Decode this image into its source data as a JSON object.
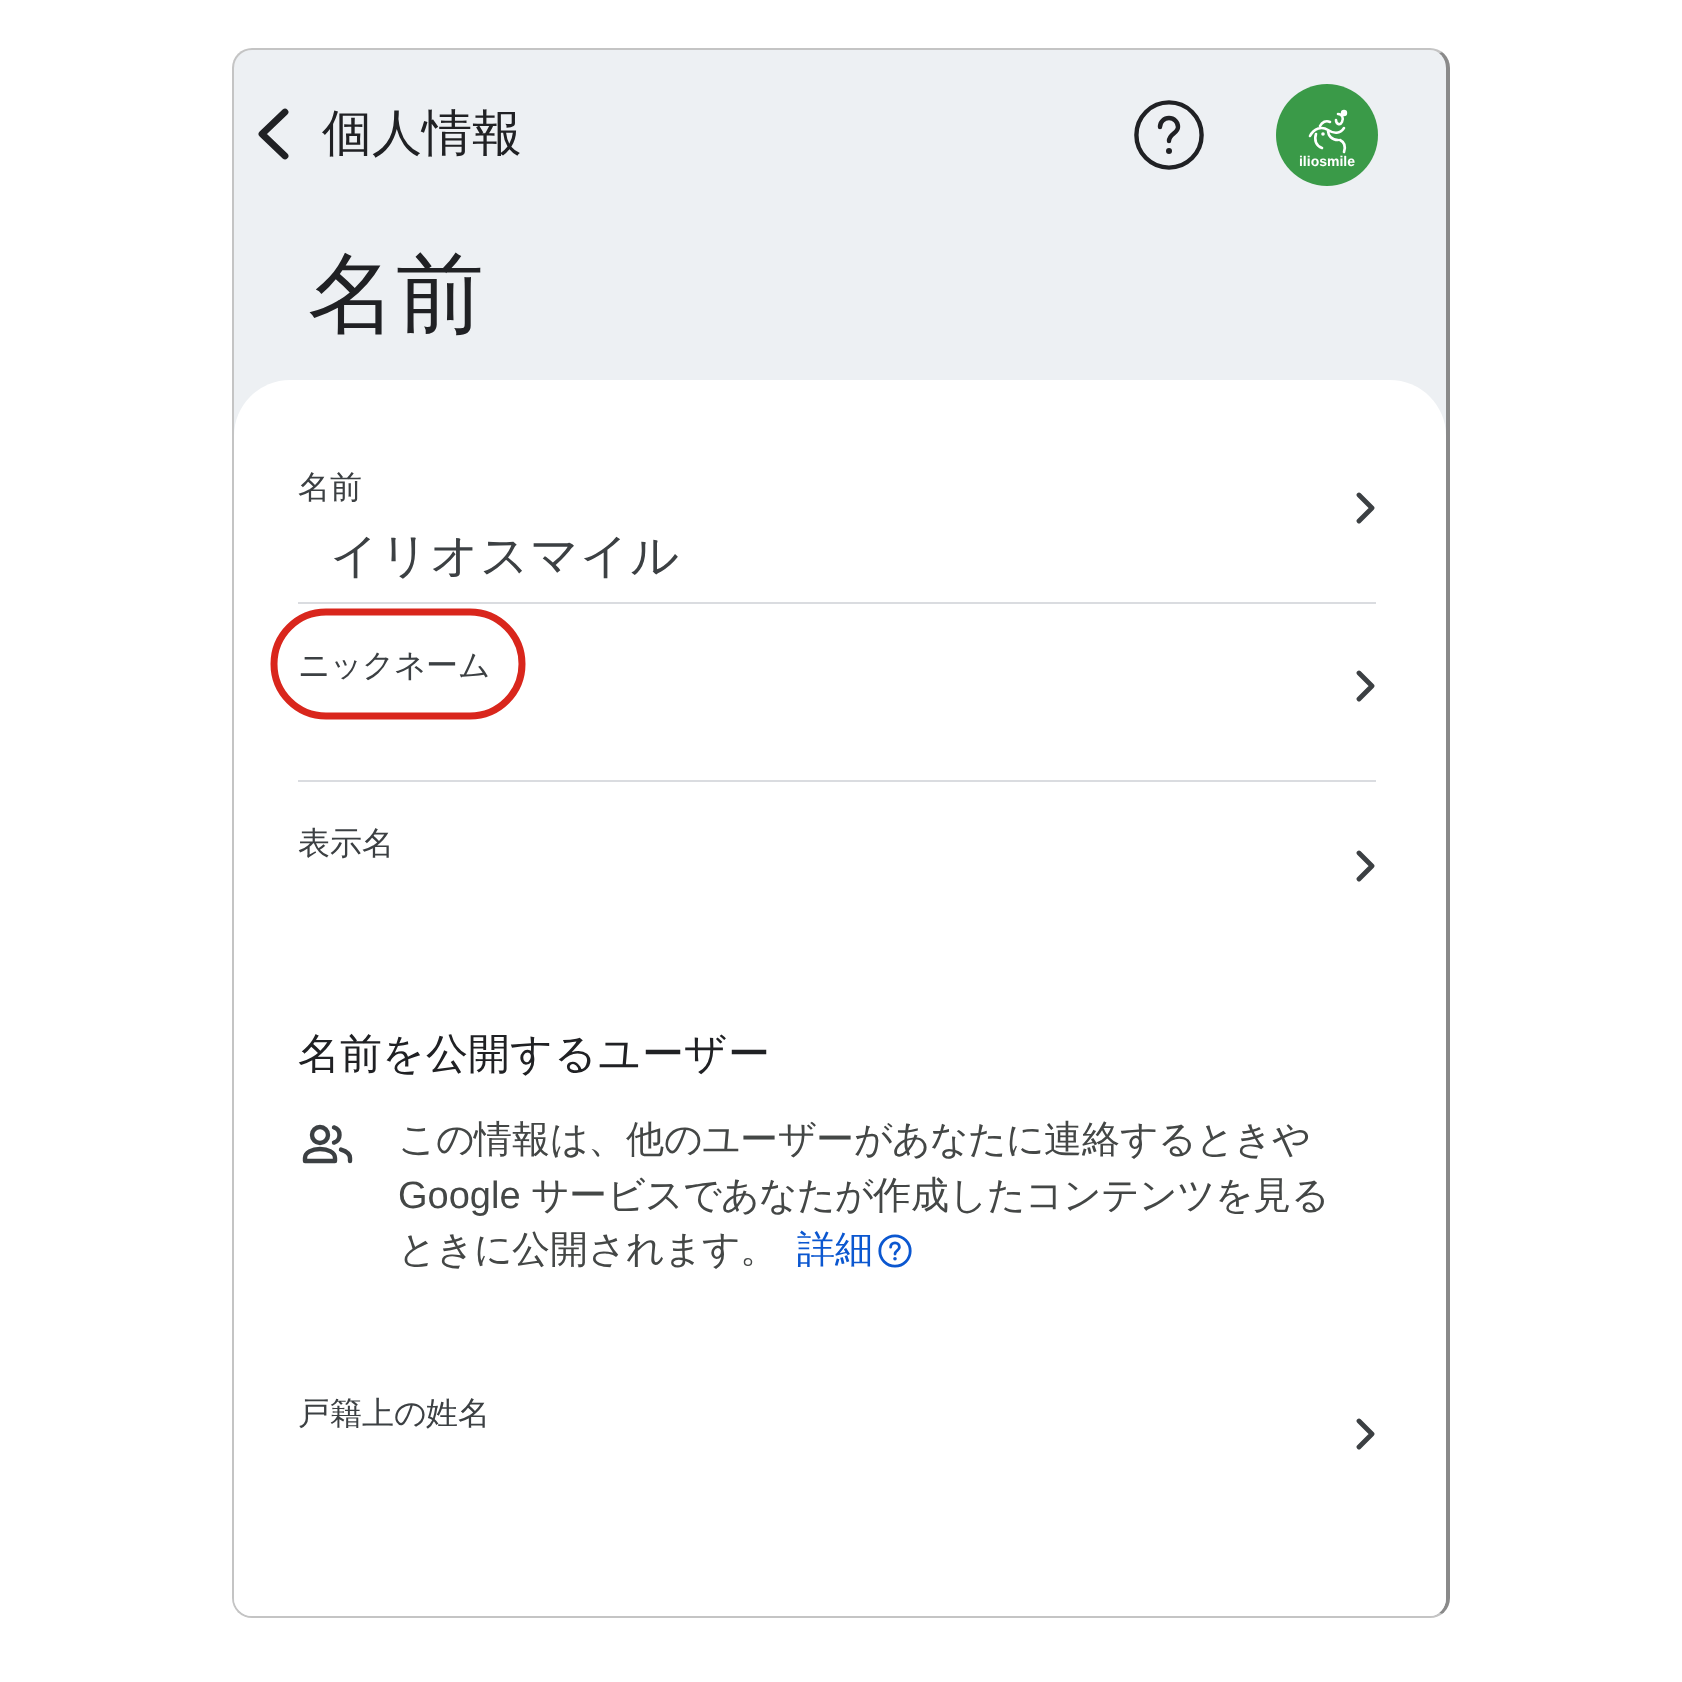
{
  "header": {
    "back_label": "個人情報",
    "avatar_text": "iliosmile"
  },
  "title": "名前",
  "name_rows": [
    {
      "label": "名前",
      "value": "イリオスマイル",
      "highlighted": false
    },
    {
      "label": "ニックネーム",
      "highlighted": true
    },
    {
      "label": "表示名",
      "highlighted": false
    }
  ],
  "visibility": {
    "heading": "名前を公開するユーザー",
    "description": "この情報は、他のユーザーがあなたに連絡するときやGoogle サービスであなたが作成したコンテンツを見るときに公開されます。",
    "link": "詳細"
  },
  "legal_name": {
    "label": "戸籍上の姓名"
  }
}
